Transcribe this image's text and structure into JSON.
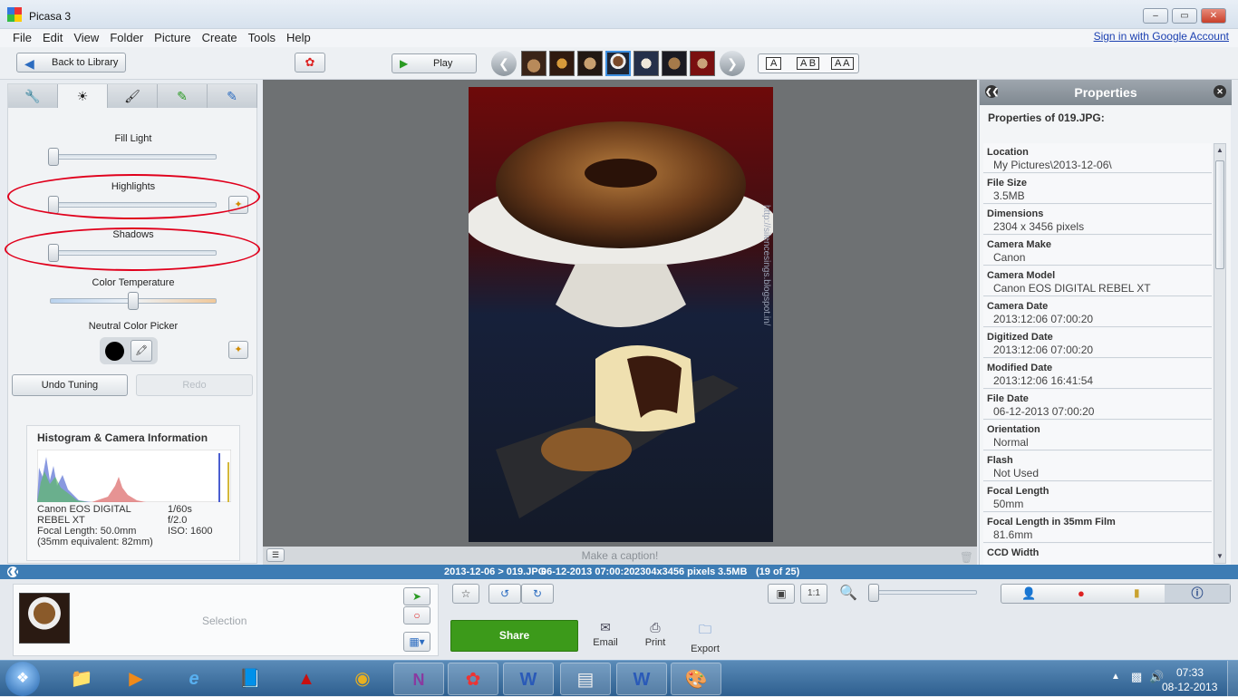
{
  "window": {
    "title": "Picasa 3",
    "minimize": "–",
    "restore": "▭",
    "close": "✕"
  },
  "menu": [
    "File",
    "Edit",
    "View",
    "Folder",
    "Picture",
    "Create",
    "Tools",
    "Help"
  ],
  "signin": "Sign in with Google Account",
  "toolbar": {
    "back": "Back to Library",
    "play": "Play",
    "view_a": "A",
    "view_ab": "A B",
    "view_aa": "A A"
  },
  "panel": {
    "fill_light": "Fill Light",
    "highlights": "Highlights",
    "shadows": "Shadows",
    "color_temp": "Color Temperature",
    "neutral": "Neutral Color Picker",
    "undo": "Undo Tuning",
    "redo": "Redo",
    "slider_fill_light": 0.0,
    "slider_highlights": 0.0,
    "slider_shadows": 0.0,
    "slider_color_temp": 0.5
  },
  "histogram": {
    "title": "Histogram & Camera Information",
    "camera": "Canon EOS DIGITAL REBEL XT",
    "focal": "Focal Length: 50.0mm",
    "equiv": "(35mm equivalent:  82mm)",
    "shutter": "1/60s",
    "aperture": "f/2.0",
    "iso": "ISO: 1600"
  },
  "caption": "Make a caption!",
  "photo_watermark": "http://silencesings.blogspot.in/",
  "properties": {
    "header": "Properties",
    "subtitle": "Properties of 019.JPG:",
    "rows": [
      {
        "k": "Location",
        "v": "My Pictures\\2013-12-06\\"
      },
      {
        "k": "File Size",
        "v": "3.5MB"
      },
      {
        "k": "Dimensions",
        "v": "2304 x 3456 pixels"
      },
      {
        "k": "Camera Make",
        "v": "Canon"
      },
      {
        "k": "Camera Model",
        "v": "Canon EOS DIGITAL REBEL XT"
      },
      {
        "k": "Camera Date",
        "v": "2013:12:06 07:00:20"
      },
      {
        "k": "Digitized Date",
        "v": "2013:12:06 07:00:20"
      },
      {
        "k": "Modified Date",
        "v": "2013:12:06 16:41:54"
      },
      {
        "k": "File Date",
        "v": "06-12-2013 07:00:20"
      },
      {
        "k": "Orientation",
        "v": "Normal"
      },
      {
        "k": "Flash",
        "v": "Not Used"
      },
      {
        "k": "Focal Length",
        "v": "50mm"
      },
      {
        "k": "Focal Length in 35mm Film",
        "v": "81.6mm"
      },
      {
        "k": "CCD Width",
        "v": ""
      }
    ]
  },
  "status": {
    "path": "2013-12-06 > 019.JPG",
    "date": "06-12-2013 07:00:20",
    "dims": "2304x3456 pixels",
    "size": "3.5MB",
    "pos": "(19 of 25)"
  },
  "tray": {
    "selection": "Selection",
    "share": "Share",
    "email": "Email",
    "print": "Print",
    "export": "Export",
    "one_to_one": "1:1",
    "zoom": 0.0
  },
  "taskbar": {
    "time": "07:33",
    "date": "08-12-2013"
  },
  "colors": {
    "accent": "#3d7cb4",
    "share": "#3c9a1a",
    "highlight_ring": "#e0001c"
  }
}
